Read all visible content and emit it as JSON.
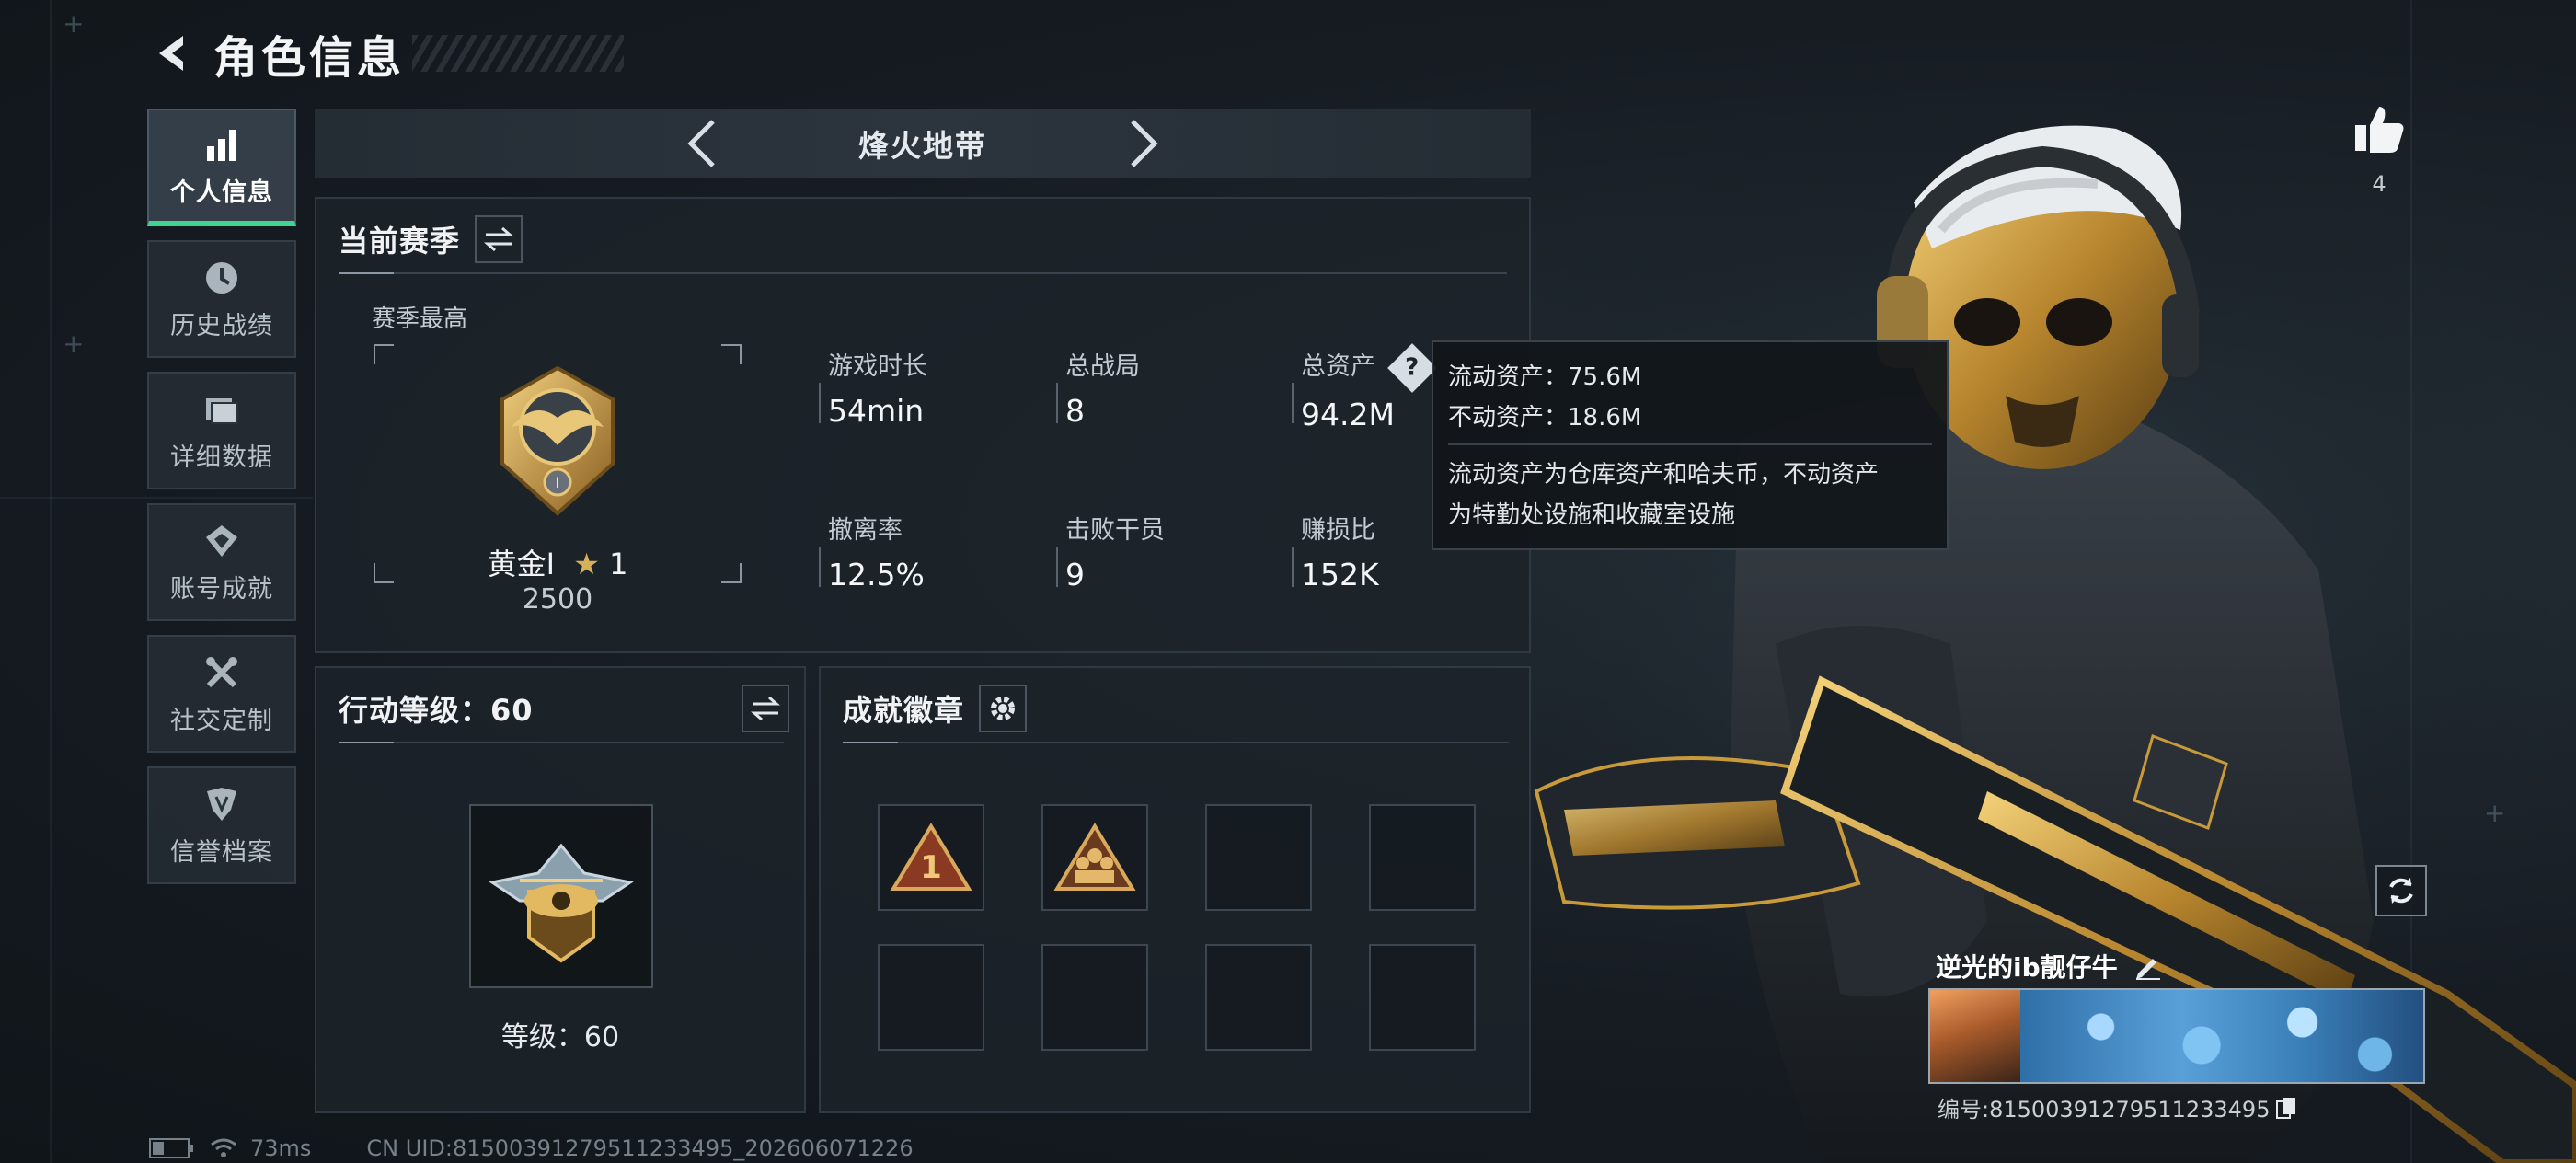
{
  "header": {
    "title": "角色信息"
  },
  "sidebar": {
    "items": [
      {
        "label": "个人信息",
        "icon": "bar-chart-icon",
        "active": true
      },
      {
        "label": "历史战绩",
        "icon": "clock-icon",
        "active": false
      },
      {
        "label": "详细数据",
        "icon": "folder-icon",
        "active": false
      },
      {
        "label": "账号成就",
        "icon": "achievement-icon",
        "active": false
      },
      {
        "label": "社交定制",
        "icon": "tools-icon",
        "active": false
      },
      {
        "label": "信誉档案",
        "icon": "shield-icon",
        "active": false
      }
    ]
  },
  "mode": {
    "name": "烽火地带"
  },
  "season": {
    "title": "当前赛季",
    "subtitle": "赛季最高",
    "rank_name": "黄金I",
    "rank_stars": "1",
    "rank_score": "2500",
    "stats": [
      {
        "label": "游戏时长",
        "value": "54min"
      },
      {
        "label": "总战局",
        "value": "8"
      },
      {
        "label": "总资产",
        "value": "94.2M"
      },
      {
        "label": "撤离率",
        "value": "12.5%"
      },
      {
        "label": "击败干员",
        "value": "9"
      },
      {
        "label": "赚损比",
        "value": "152K"
      }
    ]
  },
  "tooltip": {
    "liquid": "流动资产：75.6M",
    "fixed": "不动资产：18.6M",
    "desc_line1": "流动资产为仓库资产和哈夫币，不动资产",
    "desc_line2": "为特勤处设施和收藏室设施"
  },
  "action_level": {
    "title": "行动等级：60",
    "level_text": "等级：60"
  },
  "medals": {
    "title": "成就徽章",
    "slots": [
      "rank-one-badge",
      "squad-badge",
      "",
      "",
      "",
      "",
      "",
      ""
    ]
  },
  "profile": {
    "likes": "4",
    "player_name": "逆光的ib靓仔牛",
    "id_text": "编号:815003912795112334​95"
  },
  "footer": {
    "ping": "73ms",
    "uid": "CN UID:815003912795112334​95_202606071226"
  },
  "colors": {
    "accent": "#3fd48f",
    "gold": "#c99a3a"
  }
}
